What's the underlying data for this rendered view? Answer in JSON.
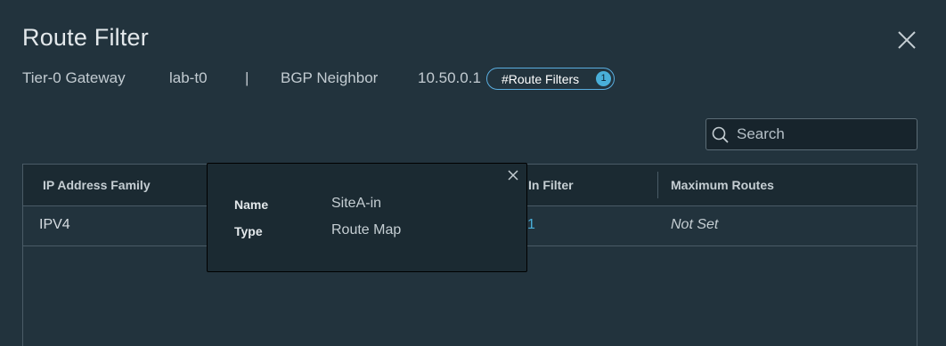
{
  "modal": {
    "title": "Route Filter",
    "close_icon": "close-icon"
  },
  "context": {
    "gateway_type": "Tier-0 Gateway",
    "gateway_name": "lab-t0",
    "separator": "|",
    "neighbor_type": "BGP Neighbor",
    "neighbor_ip": "10.50.0.1",
    "pill_label": "#Route Filters",
    "pill_count": "1"
  },
  "search": {
    "placeholder": "Search",
    "icon": "search-icon"
  },
  "table": {
    "columns": [
      "IP Address Family",
      "In Filter",
      "Maximum Routes"
    ],
    "rows": [
      {
        "ip_family": "IPV4",
        "in_filter": "1",
        "max_routes": "Not Set"
      }
    ]
  },
  "popover": {
    "name_label": "Name",
    "name_value": "SiteA-in",
    "type_label": "Type",
    "type_value": "Route Map",
    "close_icon": "close-icon"
  },
  "colors": {
    "background": "#22333d",
    "accent": "#49afd9",
    "header_bg": "#1b2a32",
    "border": "#4a5b66"
  }
}
